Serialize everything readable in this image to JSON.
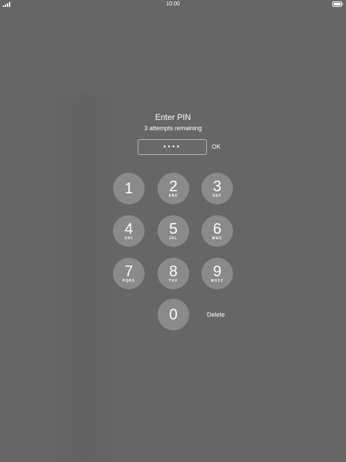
{
  "status_bar": {
    "time": "10:00"
  },
  "prompt": {
    "title": "Enter PIN",
    "subtitle": "3 attempts remaining"
  },
  "pin_field": {
    "masked_value": "••••"
  },
  "buttons": {
    "ok_label": "OK",
    "delete_label": "Delete"
  },
  "keypad": {
    "k1": {
      "digit": "1",
      "letters": ""
    },
    "k2": {
      "digit": "2",
      "letters": "ABC"
    },
    "k3": {
      "digit": "3",
      "letters": "DEF"
    },
    "k4": {
      "digit": "4",
      "letters": "GHI"
    },
    "k5": {
      "digit": "5",
      "letters": "JKL"
    },
    "k6": {
      "digit": "6",
      "letters": "MNO"
    },
    "k7": {
      "digit": "7",
      "letters": "PQRS"
    },
    "k8": {
      "digit": "8",
      "letters": "TUV"
    },
    "k9": {
      "digit": "9",
      "letters": "WXYZ"
    },
    "k0": {
      "digit": "0",
      "letters": ""
    }
  },
  "colors": {
    "background": "#666666",
    "key_fill": "#8a8a8a",
    "text": "#ffffff"
  }
}
